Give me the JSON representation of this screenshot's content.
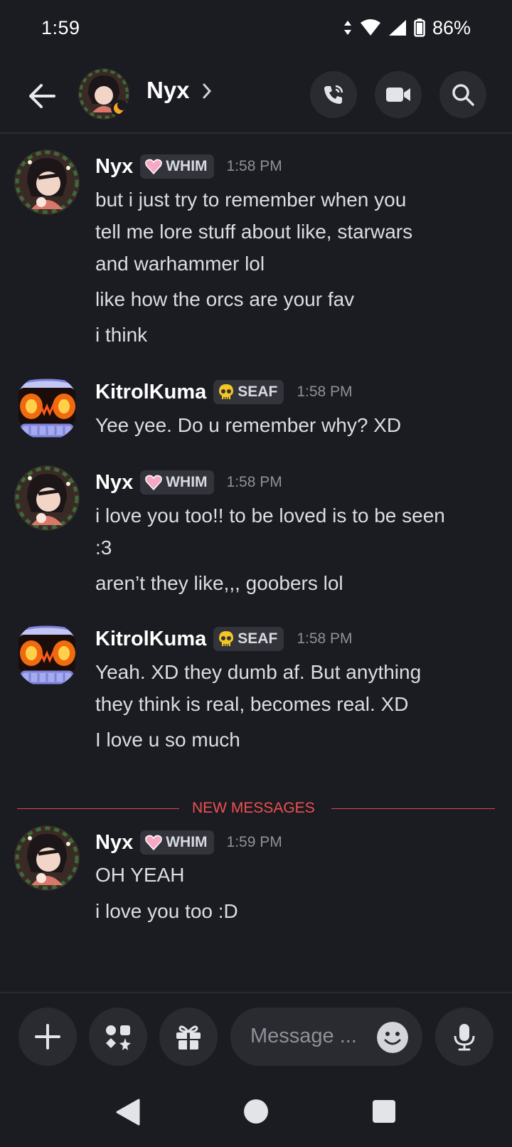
{
  "status_bar": {
    "time": "1:59",
    "battery": "86%"
  },
  "header": {
    "title": "Nyx"
  },
  "colors": {
    "background": "#1b1c21",
    "divider_accent": "#f05050",
    "tag_bg": "#33343b"
  },
  "messages": [
    {
      "author": "Nyx",
      "tag": "WHIM",
      "tag_icon": "pink-heart-icon",
      "time": "1:58 PM",
      "lines": [
        "but i just try to remember when you",
        "tell me lore stuff about like, starwars",
        "and warhammer lol",
        "like how the orcs are your fav",
        "i think"
      ]
    },
    {
      "author": "KitrolKuma",
      "tag": "SEAF",
      "tag_icon": "skull-icon",
      "time": "1:58 PM",
      "lines": [
        "Yee yee. Do u remember why? XD"
      ]
    },
    {
      "author": "Nyx",
      "tag": "WHIM",
      "tag_icon": "pink-heart-icon",
      "time": "1:58 PM",
      "lines": [
        "i love you too!! to be loved is to be seen",
        ":3",
        "aren’t they like,,, goobers lol"
      ]
    },
    {
      "author": "KitrolKuma",
      "tag": "SEAF",
      "tag_icon": "skull-icon",
      "time": "1:58 PM",
      "lines": [
        "Yeah. XD they dumb af. But anything",
        "they think is real, becomes real. XD",
        "I love u so much"
      ]
    },
    {
      "author": "Nyx",
      "tag": "WHIM",
      "tag_icon": "pink-heart-icon",
      "time": "1:59 PM",
      "lines": [
        "OH YEAH",
        "i love you too :D"
      ]
    }
  ],
  "new_messages_label": "NEW MESSAGES",
  "composer": {
    "placeholder": "Message ..."
  }
}
